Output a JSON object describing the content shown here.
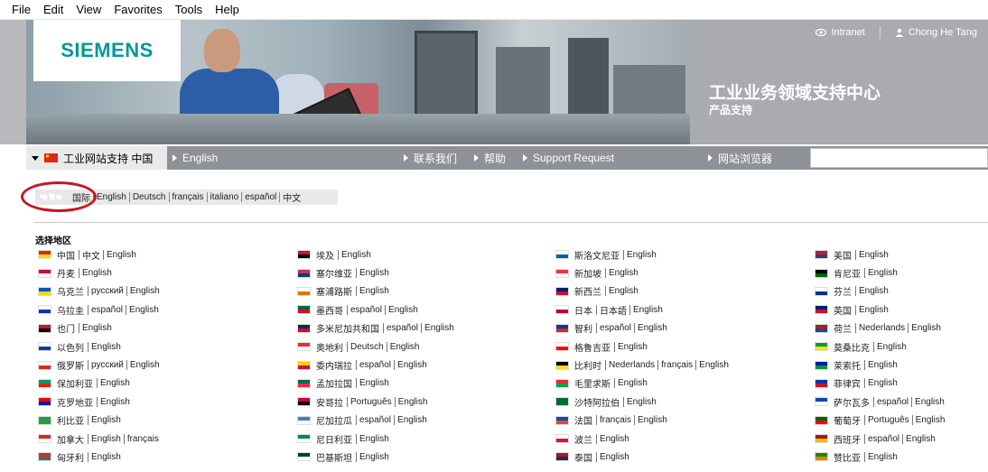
{
  "menu": [
    "File",
    "Edit",
    "View",
    "Favorites",
    "Tools",
    "Help"
  ],
  "header": {
    "logo": "SIEMENS",
    "intranet": "Intranet",
    "user": "Chong He Tang",
    "title": "工业业务领域支持中心",
    "subtitle": "产品支持"
  },
  "nav": {
    "active": "工业网站支持 中国",
    "english": "English",
    "contact": "联系我们",
    "help": "帮助",
    "support": "Support Request",
    "browser": "网站浏览器"
  },
  "languages": {
    "intl": "国际",
    "items": [
      "English",
      "Deutsch",
      "français",
      "italiano",
      "español",
      "中文"
    ]
  },
  "select_region": "选择地区",
  "colors": {
    "accent_red": "#c8151f",
    "siemens_teal": "#009999",
    "nav_gray": "#8e9196"
  },
  "countries": [
    [
      {
        "name": "中国",
        "langs": [
          "中文",
          "English"
        ],
        "flag": [
          "#de2910",
          "#ffde00"
        ]
      },
      {
        "name": "丹麦",
        "langs": [
          "English"
        ],
        "flag": [
          "#c60c30",
          "#ffffff"
        ]
      },
      {
        "name": "乌克兰",
        "langs": [
          "русский",
          "English"
        ],
        "flag": [
          "#0057b7",
          "#ffd700"
        ]
      },
      {
        "name": "乌拉圭",
        "langs": [
          "español",
          "English"
        ],
        "flag": [
          "#ffffff",
          "#0038a8"
        ]
      },
      {
        "name": "也门",
        "langs": [
          "English"
        ],
        "flag": [
          "#ce1126",
          "#000000"
        ]
      },
      {
        "name": "以色列",
        "langs": [
          "English"
        ],
        "flag": [
          "#ffffff",
          "#0038b8"
        ]
      },
      {
        "name": "俄罗斯",
        "langs": [
          "русский",
          "English"
        ],
        "flag": [
          "#ffffff",
          "#d52b1e"
        ]
      },
      {
        "name": "保加利亚",
        "langs": [
          "English"
        ],
        "flag": [
          "#00966e",
          "#d62612"
        ]
      },
      {
        "name": "克罗地亚",
        "langs": [
          "English"
        ],
        "flag": [
          "#ff0000",
          "#171796"
        ]
      },
      {
        "name": "利比亚",
        "langs": [
          "English"
        ],
        "flag": [
          "#239e46",
          "#239e46"
        ]
      },
      {
        "name": "加拿大",
        "langs": [
          "English",
          "français"
        ],
        "flag": [
          "#d52b1e",
          "#ffffff"
        ]
      },
      {
        "name": "匈牙利",
        "langs": [
          "English"
        ],
        "flag": [
          "#ce2939",
          "#477050"
        ]
      }
    ],
    [
      {
        "name": "埃及",
        "langs": [
          "English"
        ],
        "flag": [
          "#ce1126",
          "#000000"
        ]
      },
      {
        "name": "塞尔维亚",
        "langs": [
          "English"
        ],
        "flag": [
          "#c6363c",
          "#0c4076"
        ]
      },
      {
        "name": "塞浦路斯",
        "langs": [
          "English"
        ],
        "flag": [
          "#ffffff",
          "#d57800"
        ]
      },
      {
        "name": "墨西哥",
        "langs": [
          "español",
          "English"
        ],
        "flag": [
          "#006847",
          "#ce1126"
        ]
      },
      {
        "name": "多米尼加共和国",
        "langs": [
          "español",
          "English"
        ],
        "flag": [
          "#002d62",
          "#ce1126"
        ]
      },
      {
        "name": "奥地利",
        "langs": [
          "Deutsch",
          "English"
        ],
        "flag": [
          "#ed2939",
          "#ffffff"
        ]
      },
      {
        "name": "委内瑞拉",
        "langs": [
          "español",
          "English"
        ],
        "flag": [
          "#ffcc00",
          "#cf142b"
        ]
      },
      {
        "name": "孟加拉国",
        "langs": [
          "English"
        ],
        "flag": [
          "#006a4e",
          "#f42a41"
        ]
      },
      {
        "name": "安哥拉",
        "langs": [
          "Português",
          "English"
        ],
        "flag": [
          "#cc092f",
          "#000000"
        ]
      },
      {
        "name": "尼加拉瓜",
        "langs": [
          "español",
          "English"
        ],
        "flag": [
          "#3e7fca",
          "#ffffff"
        ]
      },
      {
        "name": "尼日利亚",
        "langs": [
          "English"
        ],
        "flag": [
          "#008751",
          "#ffffff"
        ]
      },
      {
        "name": "巴基斯坦",
        "langs": [
          "English"
        ],
        "flag": [
          "#01411c",
          "#ffffff"
        ]
      }
    ],
    [
      {
        "name": "斯洛文尼亚",
        "langs": [
          "English"
        ],
        "flag": [
          "#ffffff",
          "#005da4"
        ]
      },
      {
        "name": "新加坡",
        "langs": [
          "English"
        ],
        "flag": [
          "#ef3340",
          "#ffffff"
        ]
      },
      {
        "name": "新西兰",
        "langs": [
          "English"
        ],
        "flag": [
          "#012169",
          "#c8102e"
        ]
      },
      {
        "name": "日本",
        "langs": [
          "日本語",
          "English"
        ],
        "flag": [
          "#ffffff",
          "#bc002d"
        ]
      },
      {
        "name": "智利",
        "langs": [
          "español",
          "English"
        ],
        "flag": [
          "#0039a6",
          "#d52b1e"
        ]
      },
      {
        "name": "格鲁吉亚",
        "langs": [
          "English"
        ],
        "flag": [
          "#ffffff",
          "#ff0000"
        ]
      },
      {
        "name": "比利时",
        "langs": [
          "Nederlands",
          "français",
          "English"
        ],
        "flag": [
          "#000000",
          "#fdda24"
        ]
      },
      {
        "name": "毛里求斯",
        "langs": [
          "English"
        ],
        "flag": [
          "#ea2839",
          "#00a551"
        ]
      },
      {
        "name": "沙特阿拉伯",
        "langs": [
          "English"
        ],
        "flag": [
          "#006c35",
          "#006c35"
        ]
      },
      {
        "name": "法国",
        "langs": [
          "français",
          "English"
        ],
        "flag": [
          "#0055a4",
          "#ef4135"
        ]
      },
      {
        "name": "波兰",
        "langs": [
          "English"
        ],
        "flag": [
          "#ffffff",
          "#dc143c"
        ]
      },
      {
        "name": "泰国",
        "langs": [
          "English"
        ],
        "flag": [
          "#a51931",
          "#2d2a4a"
        ]
      }
    ],
    [
      {
        "name": "美国",
        "langs": [
          "English"
        ],
        "flag": [
          "#b22234",
          "#3c3b6e"
        ]
      },
      {
        "name": "肯尼亚",
        "langs": [
          "English"
        ],
        "flag": [
          "#000000",
          "#006600"
        ]
      },
      {
        "name": "芬兰",
        "langs": [
          "English"
        ],
        "flag": [
          "#ffffff",
          "#003580"
        ]
      },
      {
        "name": "英国",
        "langs": [
          "English"
        ],
        "flag": [
          "#012169",
          "#c8102e"
        ]
      },
      {
        "name": "荷兰",
        "langs": [
          "Nederlands",
          "English"
        ],
        "flag": [
          "#ae1c28",
          "#21468b"
        ]
      },
      {
        "name": "莫桑比克",
        "langs": [
          "English"
        ],
        "flag": [
          "#009a44",
          "#fce100"
        ]
      },
      {
        "name": "莱索托",
        "langs": [
          "English"
        ],
        "flag": [
          "#00209f",
          "#009543"
        ]
      },
      {
        "name": "菲律宾",
        "langs": [
          "English"
        ],
        "flag": [
          "#0038a8",
          "#ce1126"
        ]
      },
      {
        "name": "萨尔瓦多",
        "langs": [
          "español",
          "English"
        ],
        "flag": [
          "#0f47af",
          "#ffffff"
        ]
      },
      {
        "name": "葡萄牙",
        "langs": [
          "Português",
          "English"
        ],
        "flag": [
          "#006600",
          "#ff0000"
        ]
      },
      {
        "name": "西班牙",
        "langs": [
          "español",
          "English"
        ],
        "flag": [
          "#aa151b",
          "#f1bf00"
        ]
      },
      {
        "name": "赞比亚",
        "langs": [
          "English"
        ],
        "flag": [
          "#198a00",
          "#ef7d00"
        ]
      }
    ]
  ]
}
